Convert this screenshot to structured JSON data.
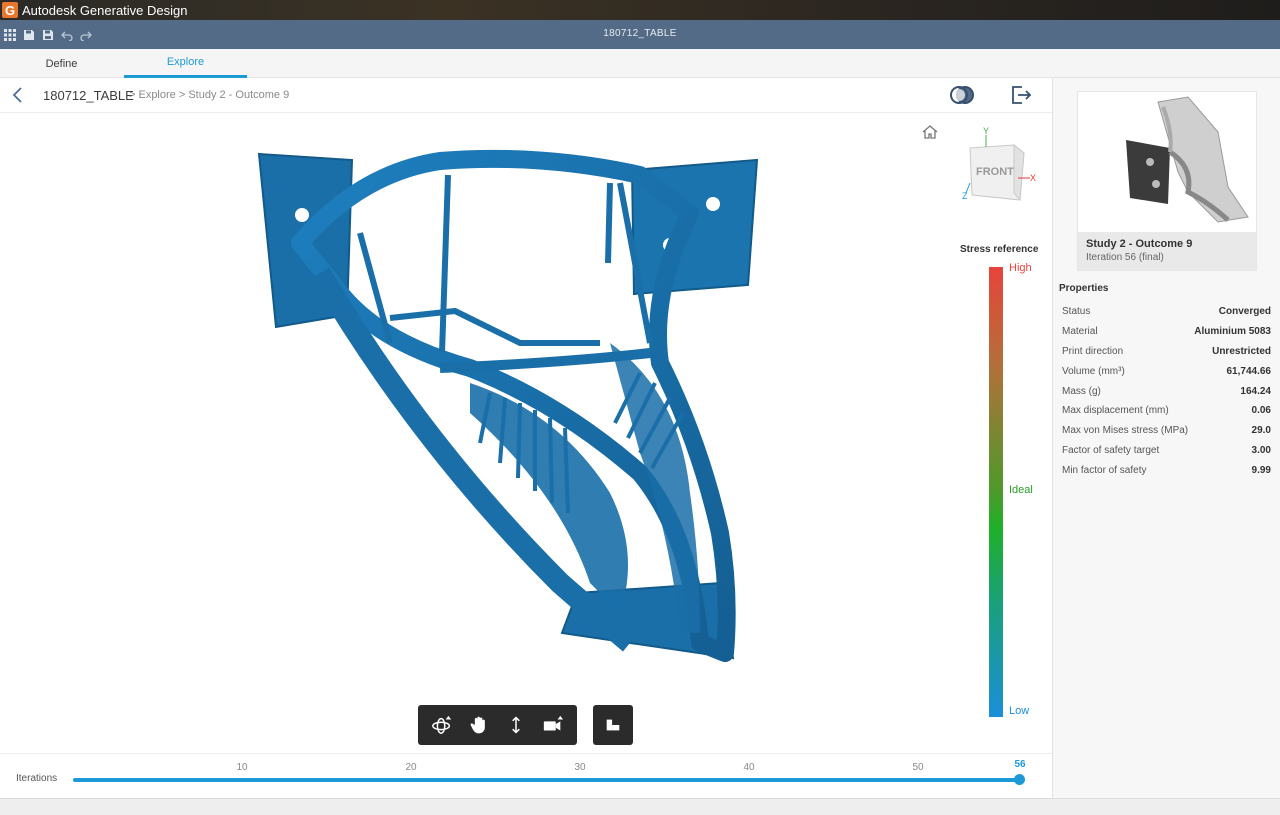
{
  "window": {
    "app_title": "Autodesk Generative Design",
    "logo_letter": "G"
  },
  "toolbar": {
    "document_title": "180712_TABLE"
  },
  "tabs": [
    {
      "label": "Define"
    },
    {
      "label": "Explore"
    }
  ],
  "breadcrumb": {
    "root": "180712_TABLE",
    "path": "> Explore > Study 2 - Outcome 9"
  },
  "legend": {
    "title": "Stress reference",
    "high": "High",
    "ideal": "Ideal",
    "low": "Low"
  },
  "viewcube": {
    "face_label": "FRONT",
    "axis_y": "Y",
    "axis_x": "X",
    "axis_z": "Z"
  },
  "iterations": {
    "label": "Iterations",
    "ticks": [
      "10",
      "20",
      "30",
      "40",
      "50"
    ],
    "current": "56"
  },
  "outcome": {
    "name": "Study 2 - Outcome 9",
    "iteration": "Iteration 56 (final)"
  },
  "properties": {
    "title": "Properties",
    "rows": [
      {
        "label": "Status",
        "value": "Converged"
      },
      {
        "label": "Material",
        "value": "Aluminium 5083"
      },
      {
        "label": "Print direction",
        "value": "Unrestricted"
      },
      {
        "label": "Volume (mm³)",
        "value": "61,744.66"
      },
      {
        "label": "Mass (g)",
        "value": "164.24"
      },
      {
        "label": "Max displacement (mm)",
        "value": "0.06"
      },
      {
        "label": "Max von Mises stress (MPa)",
        "value": "29.0"
      },
      {
        "label": "Factor of safety target",
        "value": "3.00"
      },
      {
        "label": "Min factor of safety",
        "value": "9.99"
      }
    ]
  },
  "colors": {
    "accent": "#1d9ad6",
    "model": "#1a6fa8",
    "toolbar": "#536b87"
  }
}
